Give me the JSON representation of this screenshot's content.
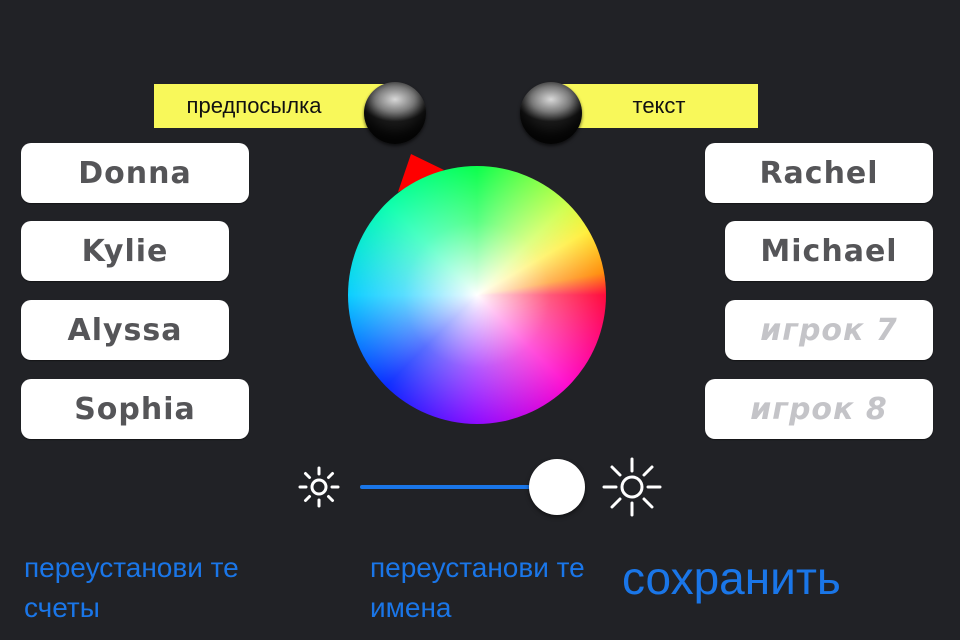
{
  "toggles": {
    "background_label": "предпосылка",
    "text_label": "текст"
  },
  "players_left": [
    {
      "name": "Donna",
      "placeholder": false
    },
    {
      "name": "Kylie",
      "placeholder": false
    },
    {
      "name": "Alyssa",
      "placeholder": false
    },
    {
      "name": "Sophia",
      "placeholder": false
    }
  ],
  "players_right": [
    {
      "name": "Rachel",
      "placeholder": false
    },
    {
      "name": "Michael",
      "placeholder": false
    },
    {
      "name": "игрок 7",
      "placeholder": true
    },
    {
      "name": "игрок 8",
      "placeholder": true
    }
  ],
  "color_wheel": {
    "selected_color": "#ff0000",
    "marker_icon": "triangle-marker"
  },
  "brightness_slider": {
    "value": 0.85,
    "min_icon": "sun-small-icon",
    "max_icon": "sun-large-icon",
    "track_color": "#1a76e8"
  },
  "actions": {
    "reset_scores": "переустанови те счеты",
    "reset_names": "переустанови те имена",
    "save": "сохранить"
  },
  "colors": {
    "background": "#212226",
    "toggle_bar": "#f8f85a",
    "link": "#1a76e8",
    "name_text": "#555558",
    "placeholder_text": "#c4c4c8"
  }
}
